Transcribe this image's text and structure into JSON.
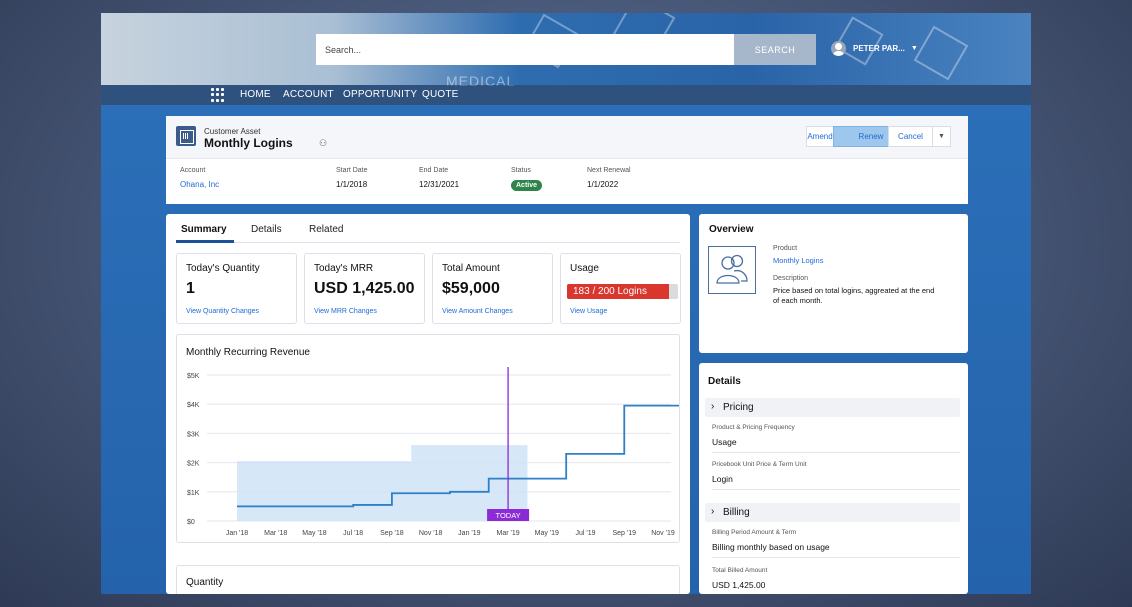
{
  "search": {
    "placeholder": "Search...",
    "button_label": "SEARCH"
  },
  "hero": {
    "background_text": "MEDICAL"
  },
  "user": {
    "name": "PETER PAR..."
  },
  "nav": {
    "items": [
      "HOME",
      "ACCOUNT",
      "OPPORTUNITY",
      "QUOTE"
    ]
  },
  "record": {
    "type_label": "Customer Asset",
    "title": "Monthly Logins",
    "buttons": {
      "amend": "Amend",
      "renew": "Renew",
      "cancel": "Cancel"
    },
    "fields": {
      "account_label": "Account",
      "account_value": "Ohana, Inc",
      "start_label": "Start Date",
      "start_value": "1/1/2018",
      "end_label": "End Date",
      "end_value": "12/31/2021",
      "status_label": "Status",
      "status_value": "Active",
      "renewal_label": "Next Renewal",
      "renewal_value": "1/1/2022"
    }
  },
  "tabs": [
    "Summary",
    "Details",
    "Related"
  ],
  "metrics": [
    {
      "title": "Today's Quantity",
      "value": "1",
      "link": "View Quantity Changes"
    },
    {
      "title": "Today's MRR",
      "value": "USD 1,425.00",
      "link": "View MRR Changes"
    },
    {
      "title": "Total Amount",
      "value": "$59,000",
      "link": "View Amount Changes"
    },
    {
      "title": "Usage",
      "value": "183 / 200 Logins",
      "link": "View Usage",
      "used": 183,
      "total": 200
    }
  ],
  "chart_title": "Monthly Recurring Revenue",
  "quantity_title": "Quantity",
  "overview": {
    "title": "Overview",
    "product_label": "Product",
    "product_value": "Monthly Logins",
    "description_label": "Description",
    "description_value": "Price based on total logins, aggreated at the end of each month."
  },
  "details": {
    "title": "Details",
    "pricing_section": "Pricing",
    "product_freq_label": "Product & Pricing Frequency",
    "product_freq_value": "Usage",
    "pricebook_label": "Pricebook Unit Price & Term Unit",
    "pricebook_value": "Login",
    "billing_section": "Billing",
    "billing_period_label": "Billing Period Amount & Term",
    "billing_period_value": "Billing monthly based on usage",
    "total_billed_label": "Total Billed Amount",
    "total_billed_value": "USD 1,425.00"
  },
  "colors": {
    "accent": "#1e6bd6",
    "status_active": "#2e844a",
    "usage_fill": "#d9362e",
    "today_marker": "#8a2bd6",
    "line": "#2f7fc9",
    "area": "#cfe3f7"
  },
  "chart_data": {
    "type": "line",
    "title": "Monthly Recurring Revenue",
    "x_ticks": [
      "Jan '18",
      "Mar '18",
      "May '18",
      "Jul '18",
      "Sep '18",
      "Nov '18",
      "Jan '19",
      "Mar '19",
      "May '19",
      "Jul '19",
      "Sep '19",
      "Nov '19"
    ],
    "y_ticks": [
      "$0",
      "$1K",
      "$2K",
      "$3K",
      "$4K",
      "$5K"
    ],
    "ylim": [
      0,
      5000
    ],
    "marker_label": "TODAY",
    "marker_x": "Mar '19",
    "series": [
      {
        "type": "step-line",
        "x": [
          "Jan '18",
          "Feb '18",
          "Jul '18",
          "Sep '18",
          "Dec '18",
          "Feb '19",
          "Apr '19",
          "Jun '19",
          "Sep '19",
          "Dec '19"
        ],
        "values": [
          500,
          500,
          550,
          950,
          1000,
          1450,
          1450,
          2300,
          3950,
          4000
        ]
      },
      {
        "type": "area",
        "x": [
          "Jan '18",
          "Jul '18",
          "Oct '18",
          "Apr '19"
        ],
        "values": [
          2050,
          2050,
          2600,
          2600
        ]
      }
    ],
    "grid": true
  }
}
